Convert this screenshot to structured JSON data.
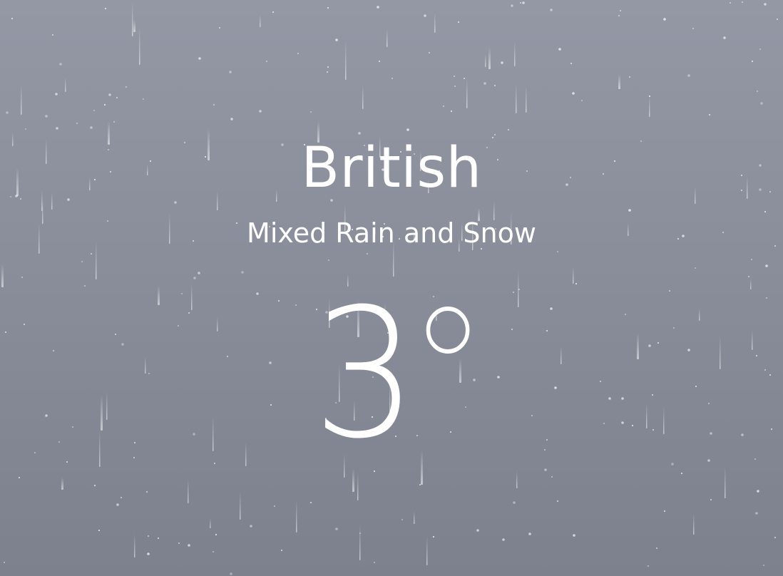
{
  "weather": {
    "location": "British",
    "condition": "Mixed Rain and Snow",
    "temperature": "3",
    "degree_symbol": "°"
  },
  "theme": {
    "background_top": "#9498a5",
    "background_bottom": "#7d818d",
    "text_color": "#ffffff"
  }
}
